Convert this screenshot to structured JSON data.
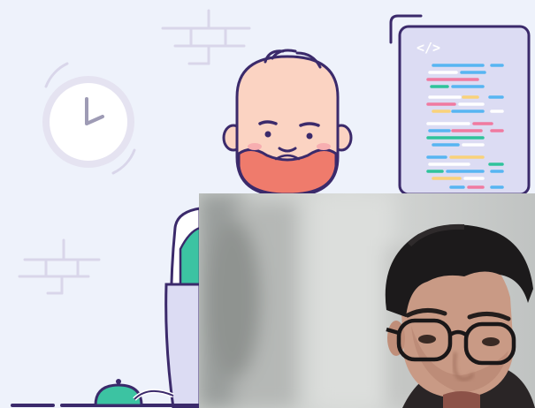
{
  "editor_panel": {
    "code_symbol": "</>"
  },
  "colors": {
    "background": "#eef2fb",
    "outline": "#3b2a6b",
    "skin": "#fbd3c2",
    "beard": "#ef7b6c",
    "hoodie": "#3cc3a2",
    "panel": "#dcdcf3",
    "code_blue": "#57b5f2",
    "code_pink": "#f07aa0",
    "code_yellow": "#f9d27a",
    "code_green": "#2fc39b",
    "code_white": "#ffffff"
  },
  "icons": [
    "clock-icon",
    "brick-icon",
    "code-icon"
  ]
}
